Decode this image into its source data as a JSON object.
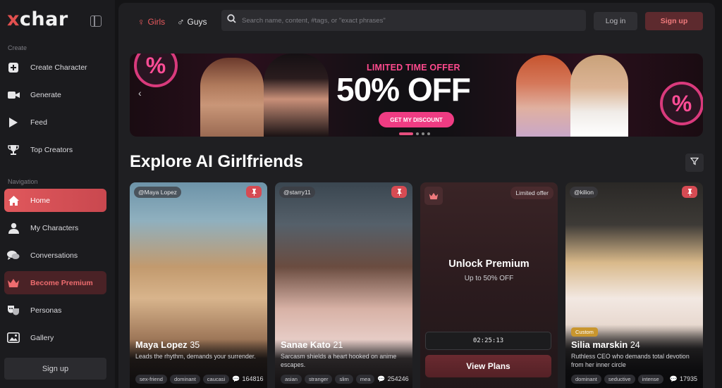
{
  "brand": {
    "logo_x": "x",
    "logo_rest": "char",
    "accent": "#e2504f"
  },
  "sidebar": {
    "create_label": "Create",
    "create_items": [
      {
        "label": "Create Character",
        "icon": "plus-square-icon"
      },
      {
        "label": "Generate",
        "icon": "video-camera-icon"
      },
      {
        "label": "Feed",
        "icon": "play-icon"
      },
      {
        "label": "Top Creators",
        "icon": "trophy-icon"
      }
    ],
    "navigation_label": "Navigation",
    "nav_items": [
      {
        "label": "Home",
        "icon": "home-icon",
        "state": "active"
      },
      {
        "label": "My Characters",
        "icon": "user-icon"
      },
      {
        "label": "Conversations",
        "icon": "chat-bubbles-icon"
      },
      {
        "label": "Become Premium",
        "icon": "crown-icon",
        "state": "premium"
      },
      {
        "label": "Personas",
        "icon": "theater-masks-icon"
      },
      {
        "label": "Gallery",
        "icon": "image-gallery-icon"
      }
    ],
    "signup_label": "Sign up"
  },
  "topbar": {
    "girls_label": "Girls",
    "guys_label": "Guys",
    "search_placeholder": "Search name, content, #tags, or \"exact phrases\"",
    "login_label": "Log in",
    "signup_label": "Sign up"
  },
  "banner": {
    "offer_label": "LIMITED TIME OFFER",
    "headline": "50% OFF",
    "cta_label": "GET MY DISCOUNT",
    "percent_symbol": "%",
    "prev_arrow": "‹",
    "active_slide": 1,
    "slide_count": 4
  },
  "main": {
    "title": "Explore AI Girlfriends"
  },
  "cards": [
    {
      "handle": "@Maya Lopez",
      "name": "Maya Lopez",
      "age": "35",
      "desc": "Leads the rhythm, demands your surrender.",
      "tags": [
        "sex-friend",
        "dominant",
        "caucasi"
      ],
      "views": "164816"
    },
    {
      "handle": "@starry11",
      "name": "Sanae Kato",
      "age": "21",
      "desc": "Sarcasm shields a heart hooked on anime escapes.",
      "tags": [
        "asian",
        "stranger",
        "slim",
        "mea"
      ],
      "views": "254246"
    },
    {
      "limited_label": "Limited offer",
      "title": "Unlock Premium",
      "subtitle": "Up to 50% OFF",
      "timer": "02:25:13",
      "button_label": "View Plans"
    },
    {
      "handle": "@kilion",
      "badge": "Custom",
      "name": "Silia marskin",
      "age": "24",
      "desc": "Ruthless CEO who demands total devotion from her inner circle",
      "tags": [
        "dominant",
        "seductive",
        "intense"
      ],
      "views": "17935"
    }
  ]
}
